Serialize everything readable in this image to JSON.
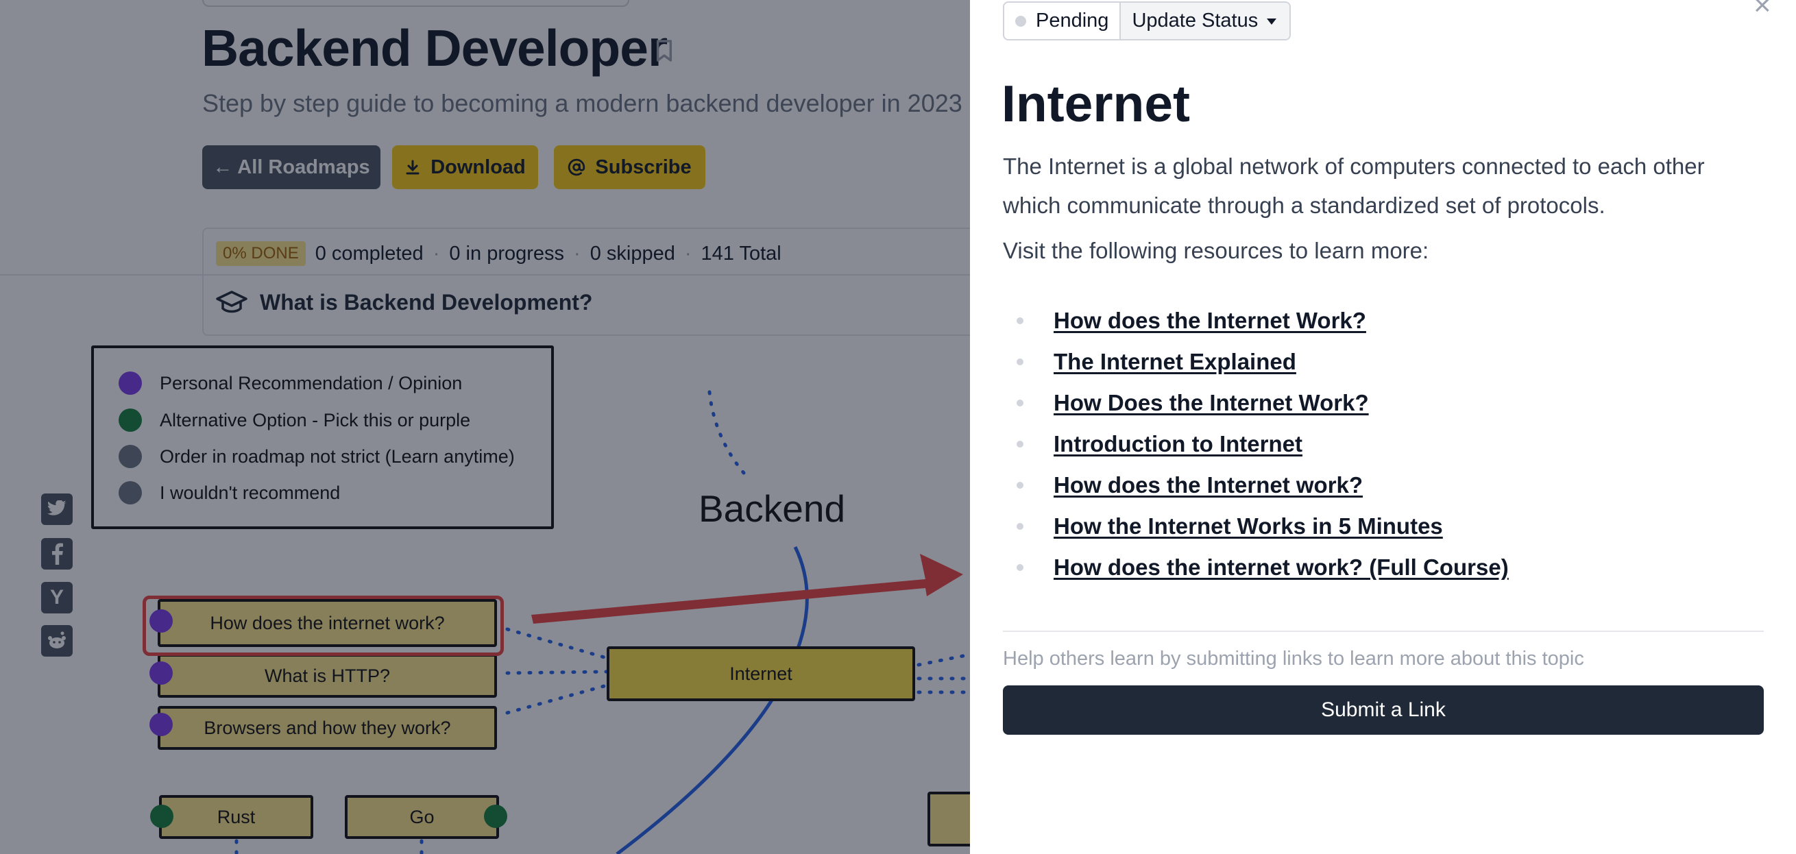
{
  "page": {
    "title": "Backend Developer",
    "description": "Step by step guide to becoming a modern backend developer in 2023",
    "buttons": {
      "all_roadmaps": "← All Roadmaps",
      "download": "Download",
      "subscribe": "Subscribe"
    },
    "progress": {
      "done_badge": "0% DONE",
      "completed": "0 completed",
      "in_progress": "0 in progress",
      "skipped": "0 skipped",
      "total": "141 Total",
      "separator": "·"
    },
    "what_is": "What is Backend Development?"
  },
  "roadmap": {
    "legend": [
      {
        "label": "Personal Recommendation / Opinion",
        "color": "#7c3aed"
      },
      {
        "label": "Alternative Option - Pick this or purple",
        "color": "#15803d"
      },
      {
        "label": "Order in roadmap not strict (Learn anytime)",
        "color": "#6b7280"
      },
      {
        "label": "I wouldn't recommend",
        "color": "#6b7280"
      }
    ],
    "backend_label": "Backend",
    "main_node": "Internet",
    "nodes": [
      "How does the internet work?",
      "What is HTTP?",
      "Browsers and how they work?",
      "Rust",
      "Go"
    ],
    "colors": {
      "node_fill": "#fde68a",
      "main_fill": "#fde047",
      "connector": "#2563eb",
      "arrow": "#ef4444"
    }
  },
  "social": [
    {
      "name": "twitter-icon"
    },
    {
      "name": "facebook-icon"
    },
    {
      "name": "hackernews-icon",
      "glyph": "Y"
    },
    {
      "name": "reddit-icon"
    }
  ],
  "drawer": {
    "status_current": "Pending",
    "status_action": "Update Status",
    "close": "×",
    "title": "Internet",
    "description": "The Internet is a global network of computers connected to each other which communicate through a standardized set of protocols.",
    "visit": "Visit the following resources to learn more:",
    "links": [
      "How does the Internet Work?",
      "The Internet Explained",
      "How Does the Internet Work?",
      "Introduction to Internet",
      "How does the Internet work?",
      "How the Internet Works in 5 Minutes",
      "How does the internet work? (Full Course)"
    ],
    "help": "Help others learn by submitting links to learn more about this topic",
    "submit": "Submit a Link"
  }
}
